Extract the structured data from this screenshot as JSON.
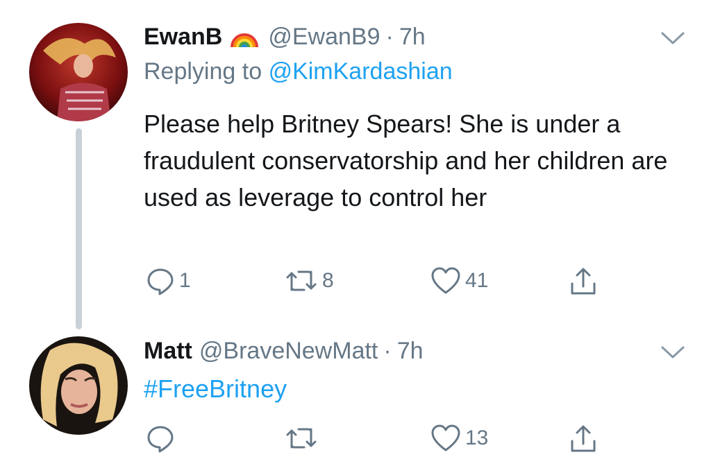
{
  "tweets": [
    {
      "display_name": "EwanB",
      "badge_icon": "rainbow-icon",
      "handle": "@EwanB9",
      "separator": "·",
      "time": "7h",
      "replying_prefix": "Replying to",
      "replying_to": "@KimKardashian",
      "text": "Please help Britney Spears! She is under a fraudulent conservatorship and her children are used as leverage to control her",
      "reply_count": "1",
      "retweet_count": "8",
      "like_count": "41"
    },
    {
      "display_name": "Matt",
      "handle": "@BraveNewMatt",
      "separator": "·",
      "time": "7h",
      "text": "#FreeBritney",
      "reply_count": "",
      "retweet_count": "",
      "like_count": "13"
    }
  ],
  "colors": {
    "link": "#1da1f2",
    "muted": "#657786",
    "text": "#14171a",
    "thread_line": "#c9d1d8"
  }
}
